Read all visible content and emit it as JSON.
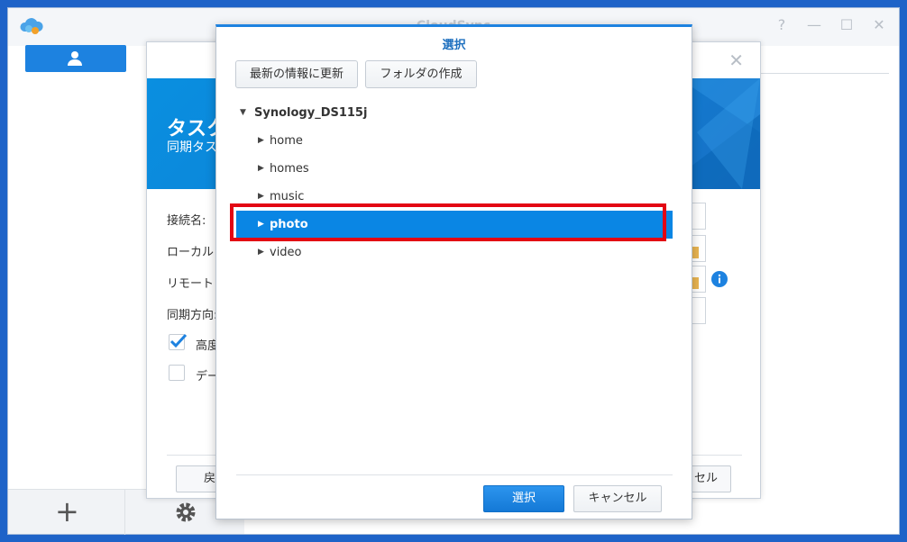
{
  "app": {
    "title": "CloudSync",
    "window_controls": [
      "?",
      "—",
      "☐",
      "✕"
    ]
  },
  "wizard": {
    "title": "タスク",
    "subtitle": "同期タス",
    "labels": {
      "connection_name": "接続名:",
      "local": "ローカル",
      "remote": "リモート",
      "sync_direction": "同期方向:",
      "advanced": "高度",
      "data": "デー"
    },
    "advanced_checked": true,
    "data_checked": false,
    "back_button": "戻",
    "cancel_button": "セル"
  },
  "dialog": {
    "title": "選択",
    "refresh_button": "最新の情報に更新",
    "create_folder_button": "フォルダの作成",
    "tree": {
      "root": "Synology_DS115j",
      "children": [
        "home",
        "homes",
        "music",
        "photo",
        "video"
      ],
      "selected": "photo"
    },
    "select_button": "選択",
    "cancel_button": "キャンセル"
  },
  "colors": {
    "accent": "#1d82e0",
    "selection": "#0a86e4",
    "highlight": "#e30613",
    "desktop": "#1e63c8"
  }
}
